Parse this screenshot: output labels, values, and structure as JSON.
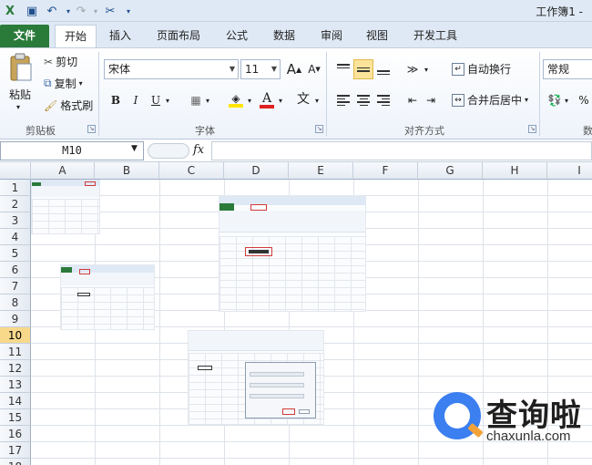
{
  "window": {
    "title": "工作簿1 -"
  },
  "tabs": [
    "文件",
    "开始",
    "插入",
    "页面布局",
    "公式",
    "数据",
    "审阅",
    "视图",
    "开发工具"
  ],
  "clipboard": {
    "paste": "粘贴",
    "cut": "剪切",
    "copy": "复制",
    "format_painter": "格式刷",
    "label": "剪贴板"
  },
  "font": {
    "name": "宋体",
    "size": "11",
    "bold": "B",
    "italic": "I",
    "underline": "U",
    "label": "字体",
    "grow": "A",
    "shrink": "A",
    "phonetic": "文"
  },
  "alignment": {
    "wrap_text": "自动换行",
    "merge_center": "合并后居中",
    "label": "对齐方式"
  },
  "number": {
    "format": "常规",
    "percent": "%",
    "label_partial": "数"
  },
  "formula_bar": {
    "name_box": "M10",
    "fx": "fx",
    "formula": ""
  },
  "grid": {
    "columns": [
      "A",
      "B",
      "C",
      "D",
      "E",
      "F",
      "G",
      "H",
      "I"
    ],
    "rows": [
      "1",
      "2",
      "3",
      "4",
      "5",
      "6",
      "7",
      "8",
      "9",
      "10",
      "11",
      "12",
      "13",
      "14",
      "15",
      "16",
      "17",
      "18"
    ],
    "active_row": "10"
  },
  "watermark": {
    "brand": "查询啦",
    "url": "chaxunla.com"
  },
  "colors": {
    "file_tab": "#2a7a3a",
    "ribbon_bg": "#dfe9f5",
    "accent_red": "#d23b3b",
    "highlight": "#fbe39a"
  }
}
